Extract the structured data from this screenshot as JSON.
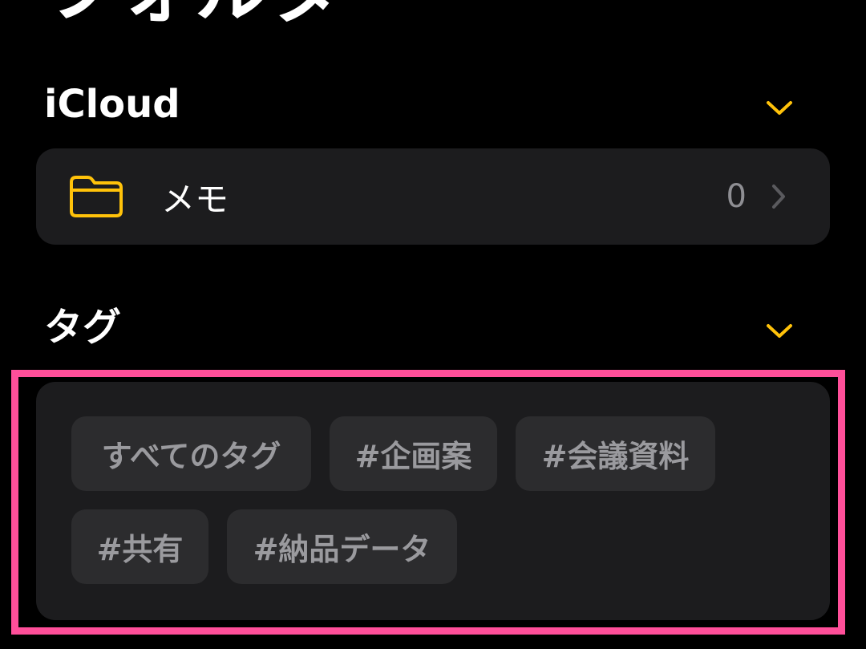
{
  "title": "フォルダ",
  "sections": {
    "icloud": {
      "title": "iCloud",
      "folders": [
        {
          "name": "メモ",
          "count": "0"
        }
      ]
    },
    "tags": {
      "title": "タグ",
      "chips": [
        "すべてのタグ",
        "#企画案",
        "#会議資料",
        "#共有",
        "#納品データ"
      ]
    }
  },
  "colors": {
    "accent": "#ffc20a",
    "background": "#000000",
    "card": "#1c1c1e",
    "chip": "#2c2c2e",
    "muted_text": "#8e8e93",
    "highlight": "#ff4f9a"
  },
  "icons": {
    "section_toggle": "chevron-down-icon",
    "folder": "folder-icon",
    "disclosure": "chevron-right-icon"
  }
}
